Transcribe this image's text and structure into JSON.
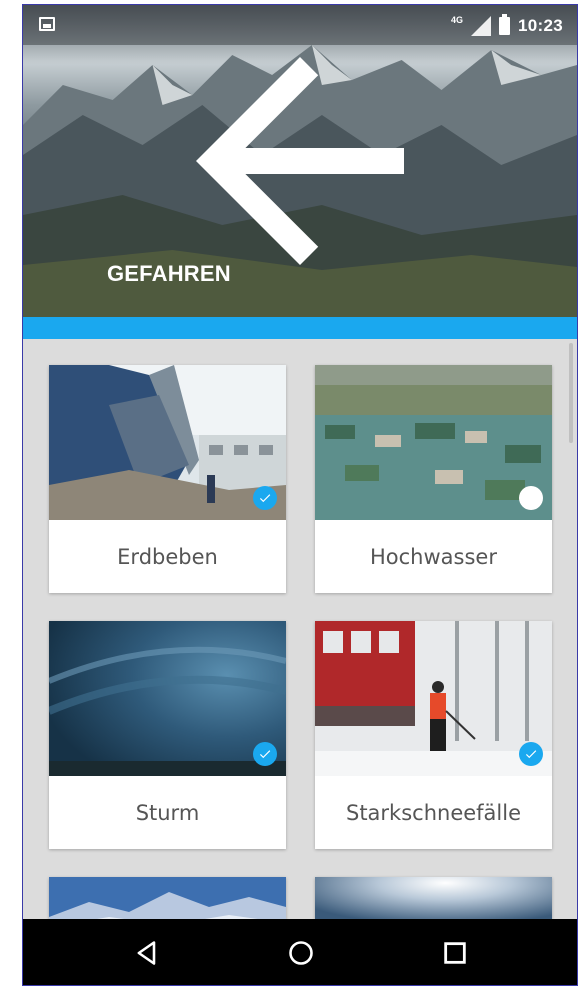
{
  "status_bar": {
    "network": "4G",
    "time": "10:23"
  },
  "header": {
    "title": "GEFAHREN",
    "back_icon": "arrow-left-icon"
  },
  "colors": {
    "accent": "#1aa8ef",
    "check_selected": "#1aa8ef",
    "check_unselected": "#ffffff"
  },
  "hazards": [
    {
      "label": "Erdbeben",
      "selected": true,
      "image": "earthquake-photo"
    },
    {
      "label": "Hochwasser",
      "selected": false,
      "image": "flood-photo"
    },
    {
      "label": "Sturm",
      "selected": true,
      "image": "storm-photo"
    },
    {
      "label": "Starkschneefälle",
      "selected": true,
      "image": "snow-photo"
    }
  ],
  "navigation": {
    "back": "triangle-back-icon",
    "home": "circle-home-icon",
    "recents": "square-recents-icon"
  }
}
